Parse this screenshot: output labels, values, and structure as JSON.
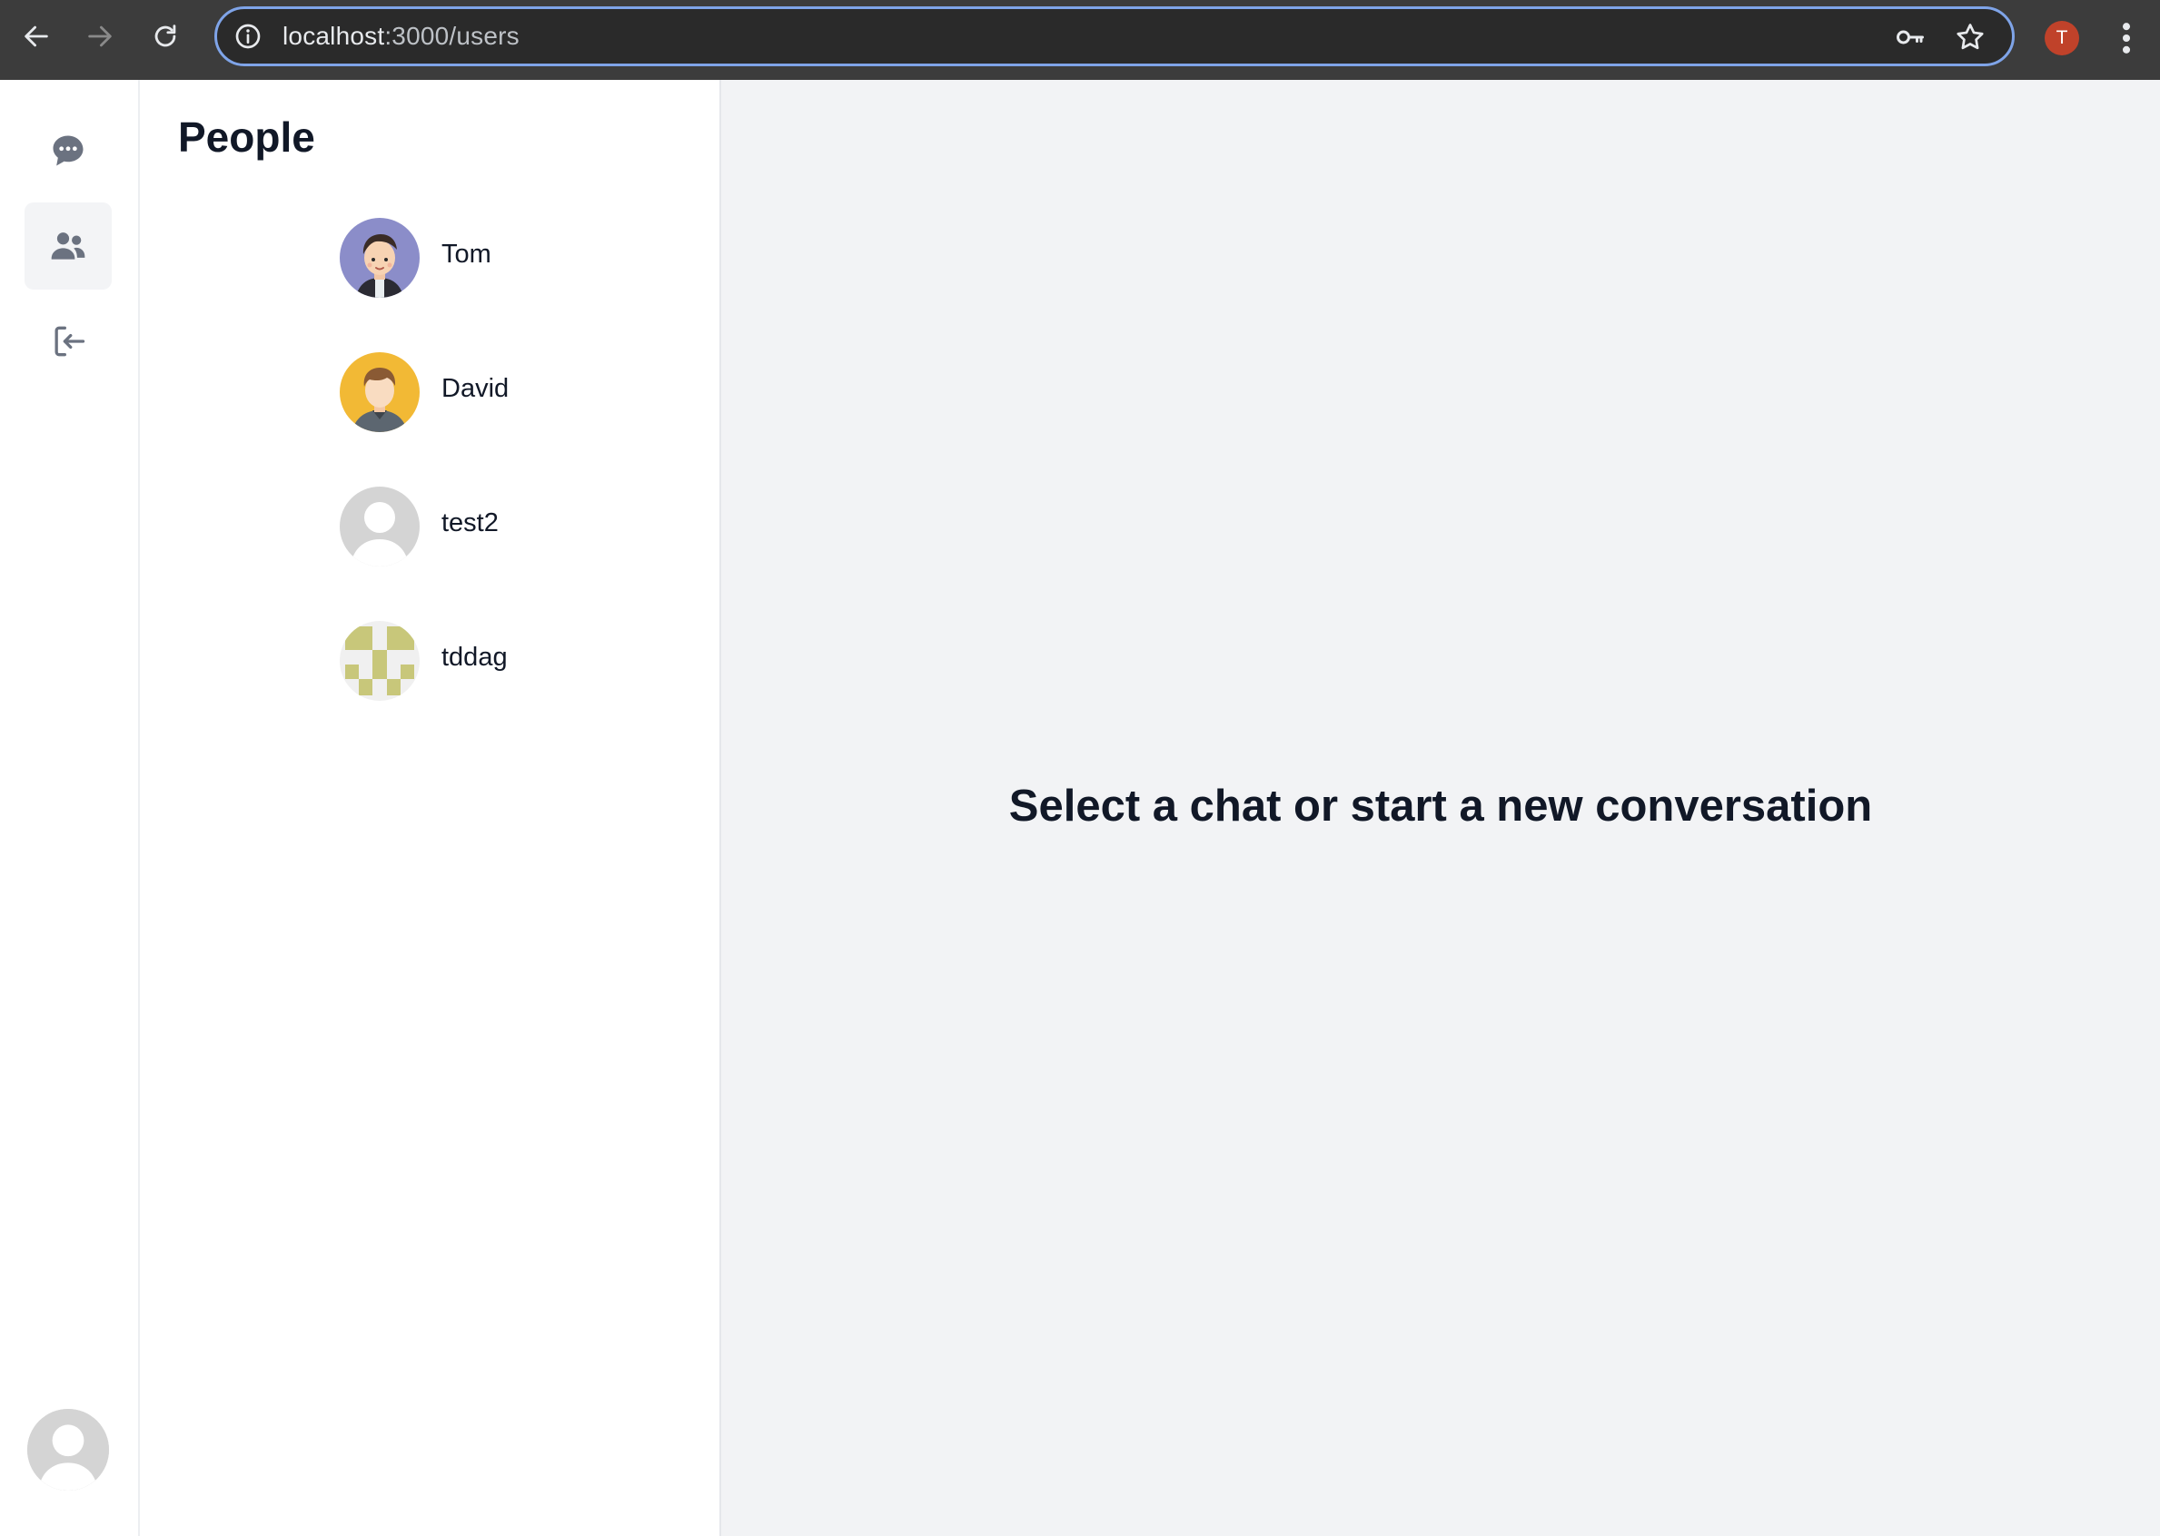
{
  "browser": {
    "url_host": "localhost",
    "url_path": ":3000/users",
    "profile_initial": "T",
    "icons": [
      "back-arrow-icon",
      "forward-arrow-icon",
      "reload-icon",
      "info-icon",
      "key-icon",
      "star-icon",
      "kebab-menu-icon"
    ]
  },
  "rail": {
    "items": [
      {
        "name": "chats",
        "icon": "chat-bubble-icon",
        "active": false
      },
      {
        "name": "people",
        "icon": "users-icon",
        "active": true
      },
      {
        "name": "logout",
        "icon": "logout-icon",
        "active": false
      }
    ]
  },
  "people": {
    "title": "People",
    "users": [
      {
        "name": "Tom",
        "avatar": "cartoon-boy-avatar"
      },
      {
        "name": "David",
        "avatar": "cartoon-man-avatar"
      },
      {
        "name": "test2",
        "avatar": "default-person-avatar"
      },
      {
        "name": "tddag",
        "avatar": "identicon-avatar"
      }
    ]
  },
  "main": {
    "placeholder": "Select a chat or start a new conversation"
  },
  "colors": {
    "chrome_bg": "#3c3c3c",
    "omnibox_focus": "#7fa4e8",
    "profile_chip": "#c0422a",
    "main_bg": "#f2f3f5",
    "text": "#111827",
    "icon_gray": "#6b7280"
  }
}
